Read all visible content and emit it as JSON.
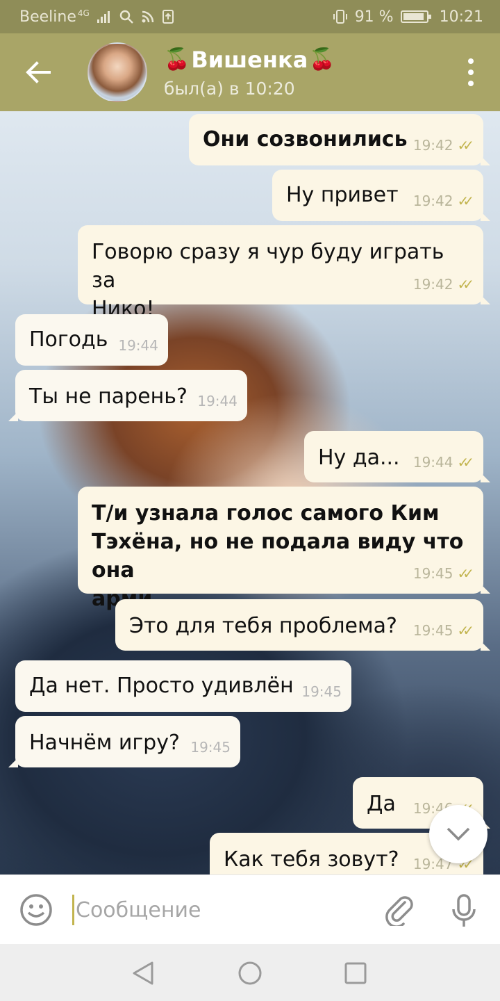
{
  "status_bar": {
    "carrier": "Beeline",
    "network": "4G",
    "battery_percent": "91 %",
    "battery_level": 0.91,
    "time": "10:21"
  },
  "header": {
    "title": "Вишенка",
    "title_decoration": "🍒",
    "status": "был(а) в 10:20",
    "icons": [
      "back-arrow-icon",
      "avatar",
      "more-vertical-icon"
    ]
  },
  "colors": {
    "header": "#a9a567",
    "status_bar": "#8f8d58",
    "bubble": "#fbf8ef",
    "check": "#c2b44e"
  },
  "messages": [
    {
      "side": "out",
      "text": "Они созвонились",
      "time": "19:42",
      "bold": true,
      "read": true
    },
    {
      "side": "out",
      "text": "Ну привет",
      "time": "19:42",
      "bold": false,
      "read": true
    },
    {
      "side": "out",
      "text": "Говорю сразу я чур буду играть за\nНико!",
      "time": "19:42",
      "bold": false,
      "read": true
    },
    {
      "side": "in",
      "text": "Погодь",
      "time": "19:44",
      "bold": false
    },
    {
      "side": "in",
      "text": "Ты не парень?",
      "time": "19:44",
      "bold": false
    },
    {
      "side": "out",
      "text": "Ну да...",
      "time": "19:44",
      "bold": false,
      "read": true
    },
    {
      "side": "out",
      "text": "Т/и узнала голос самого Ким\nТэхёна, но не подала виду что она\nарми",
      "time": "19:45",
      "bold": true,
      "read": true
    },
    {
      "side": "out",
      "text": "Это для тебя проблема?",
      "time": "19:45",
      "bold": false,
      "read": true
    },
    {
      "side": "in",
      "text": "Да нет. Просто удивлён",
      "time": "19:45",
      "bold": false
    },
    {
      "side": "in",
      "text": "Начнём игру?",
      "time": "19:45",
      "bold": false
    },
    {
      "side": "out",
      "text": "Да",
      "time": "19:46",
      "bold": false,
      "read": true
    },
    {
      "side": "out",
      "text": "Как тебя зовут?",
      "time": "19:47",
      "bold": false,
      "read": true
    }
  ],
  "input": {
    "placeholder": "Сообщение",
    "value": ""
  }
}
